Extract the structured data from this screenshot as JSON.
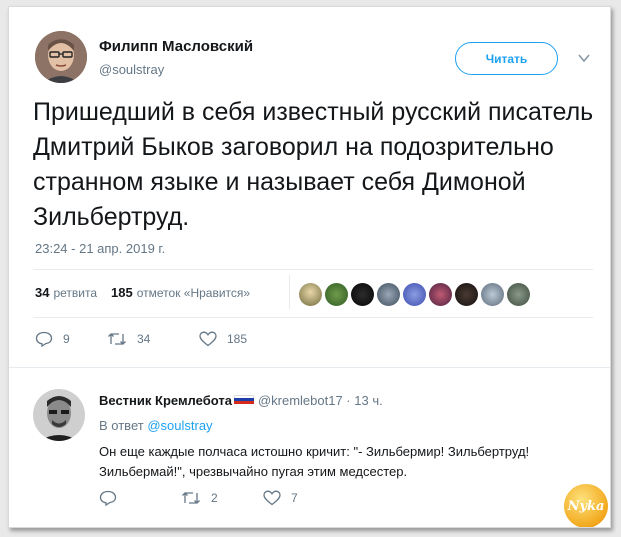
{
  "tweet": {
    "author_name": "Филипп Масловский",
    "author_handle": "@soulstray",
    "follow_label": "Читать",
    "text": "Пришедший в себя известный русский писатель Дмитрий Быков заговорил на подозрительно странном языке и называет себя Димоной Зильбертруд.",
    "timestamp": "23:24 - 21 апр. 2019 г.",
    "stats": {
      "retweets_count": "34",
      "retweets_label": "ретвита",
      "likes_count": "185",
      "likes_label": "отметок «Нравится»"
    },
    "likers": [
      "liker-1",
      "liker-2",
      "liker-3",
      "liker-4",
      "liker-5",
      "liker-6",
      "liker-7",
      "liker-8",
      "liker-9"
    ],
    "actions": {
      "replies": "9",
      "retweets": "34",
      "likes": "185"
    }
  },
  "reply": {
    "author_name": "Вестник Кремлебота",
    "author_meta": "@kremlebot17 · 13 ч.",
    "reply_to_prefix": "В ответ",
    "reply_to_handle": "@soulstray",
    "text": "Он еще каждые полчаса истошно кричит: \"- Зильбермир! Зильбертруд! Зильбермай!\", чрезвычайно пугая этим медсестер.",
    "actions": {
      "replies": "",
      "retweets": "2",
      "likes": "7"
    }
  },
  "watermark": "Nyka",
  "colors": {
    "accent": "#1da1f2",
    "muted": "#657786",
    "text": "#14171a",
    "flag": [
      "#ffffff",
      "#1c3fa8",
      "#d52b1e"
    ]
  },
  "icons": [
    "chevron-down-icon",
    "reply-icon",
    "retweet-icon",
    "like-icon"
  ]
}
